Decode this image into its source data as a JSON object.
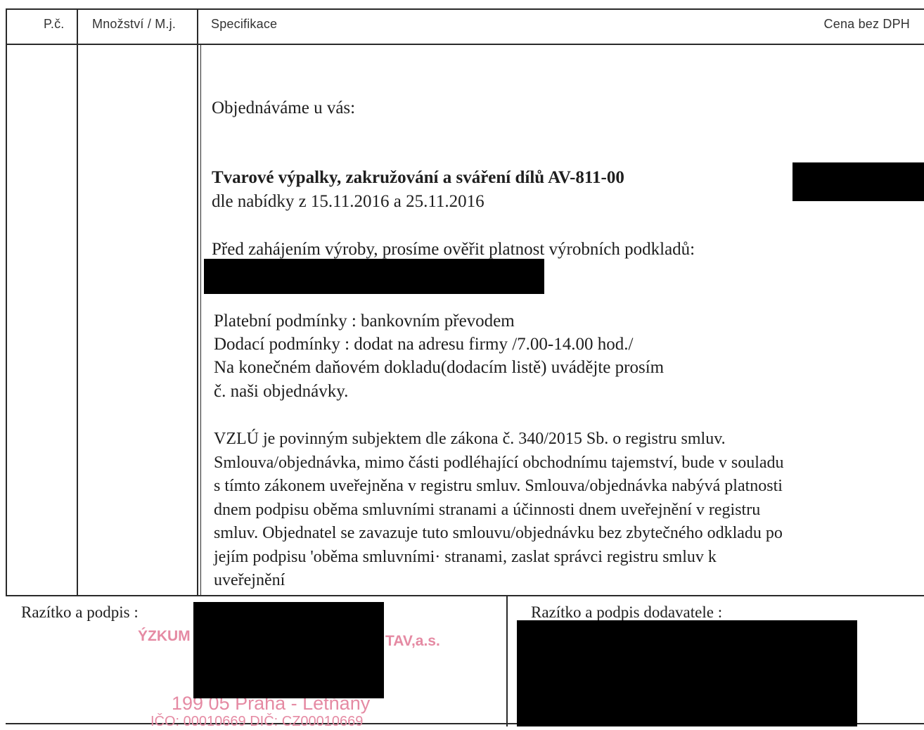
{
  "table_header": {
    "number": "P.č.",
    "quantity": "Množství / M.j.",
    "specification": "Specifikace",
    "price": "Cena bez DPH"
  },
  "body": {
    "lead": "Objednáváme u vás:",
    "item_title": "Tvarové výpalky, zakružování a sváření dílů AV-811-00",
    "item_offer": "dle nabídky z 15.11.2016 a 25.11.2016",
    "notice": "Před zahájením výroby, prosíme ověřit platnost výrobních podkladů:",
    "terms": [
      "Platební podmínky : bankovním převodem",
      "Dodací podmínky : dodat na adresu firmy /7.00-14.00 hod./",
      "Na konečném daňovém dokladu(dodacím listě)  uvádějte  prosím",
      "č. naši objednávky."
    ],
    "legal": [
      "VZLÚ je povinným  subjektem  dle  zákona  č.  340/2015  Sb.  o  registru  smluv.",
      "Smlouva/objednávka, mimo části podléhající obchodnímu tajemství, bude v  souladu",
      "s tímto zákonem uveřejněna v registru smluv. Smlouva/objednávka nabývá platnosti",
      "dnem podpisu oběma smluvními stranami a účinnosti  dnem  uveřejnění  v  registru",
      "smluv. Objednatel se zavazuje tuto smlouvu/objednávku bez zbytečného odkladu po",
      "jejím  podpisu 'oběma  smluvními· stranami,  zaslat  správci  registru  smluv  k",
      "uveřejnění"
    ]
  },
  "signatures": {
    "buyer_label": "Razítko a podpis :",
    "supplier_label": "Razítko a podpis dodavatele :",
    "stamp_line1_left": "ÝZKUM",
    "stamp_line1_right": "TAV,a.s.",
    "stamp_line2": "199 05 Praha - Letňany",
    "stamp_line3": "IČO: 00010669  DIČ: CZ00010669"
  },
  "colors": {
    "stamp": "#e58aa3",
    "redaction": "#000000"
  }
}
